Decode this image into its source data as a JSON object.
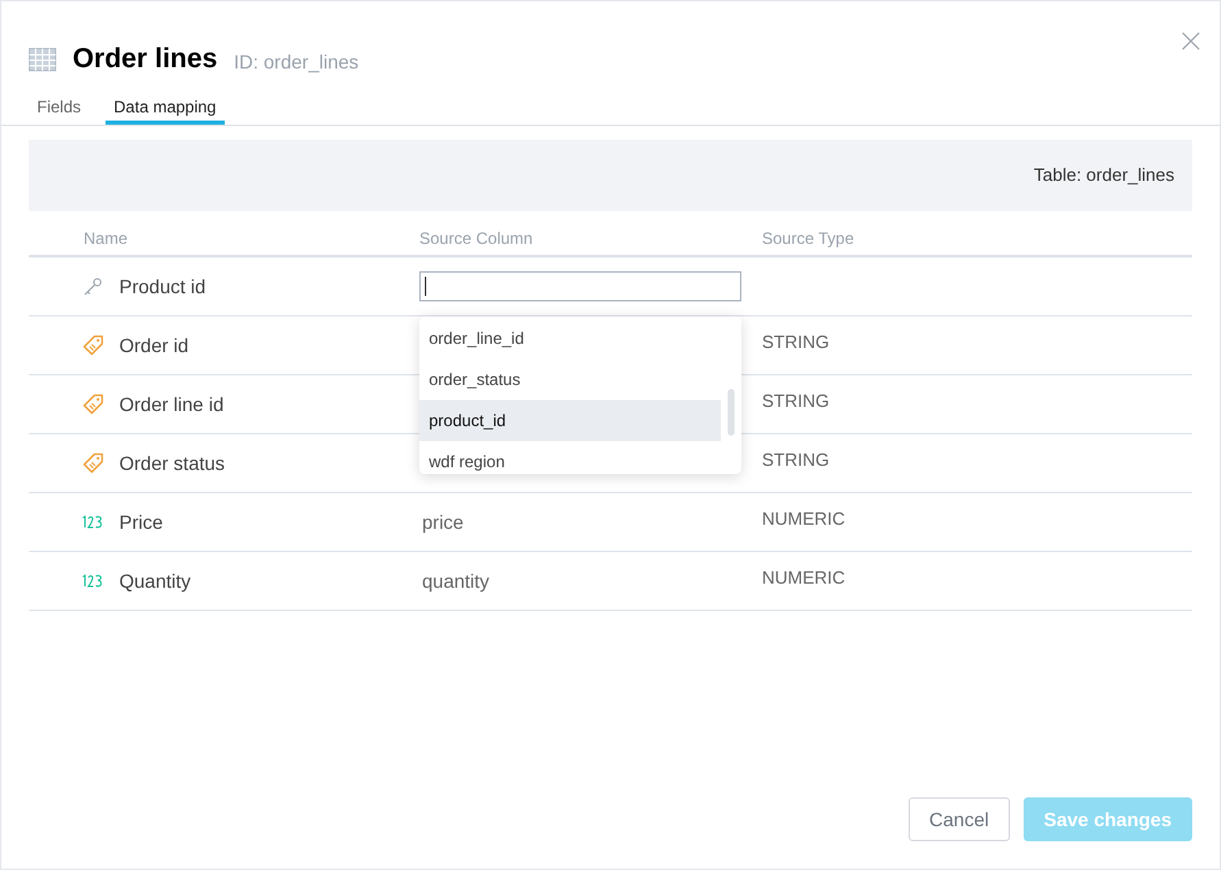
{
  "dialog": {
    "title": "Order lines",
    "id_label": "ID: order_lines"
  },
  "tabs": [
    {
      "label": "Fields",
      "selected": false
    },
    {
      "label": "Data mapping",
      "selected": true
    }
  ],
  "table_info": "Table: order_lines",
  "table": {
    "columns": [
      "Name",
      "Source Column",
      "Source Type"
    ],
    "rows": [
      {
        "kind": "key",
        "name": "Product id",
        "source": "",
        "type": "",
        "editing": true
      },
      {
        "kind": "tag",
        "name": "Order id",
        "source": "",
        "type": "STRING",
        "editing": false
      },
      {
        "kind": "tag",
        "name": "Order line id",
        "source": "",
        "type": "STRING",
        "editing": false
      },
      {
        "kind": "tag",
        "name": "Order status",
        "source": "",
        "type": "STRING",
        "editing": false
      },
      {
        "kind": "number",
        "name": "Price",
        "source": "price",
        "type": "NUMERIC",
        "editing": false
      },
      {
        "kind": "number",
        "name": "Quantity",
        "source": "quantity",
        "type": "NUMERIC",
        "editing": false
      }
    ]
  },
  "dropdown": {
    "options": [
      {
        "label": "order_line_id",
        "selected": false
      },
      {
        "label": "order_status",
        "selected": false
      },
      {
        "label": "product_id",
        "selected": true
      },
      {
        "label": "wdf region",
        "selected": false
      }
    ]
  },
  "buttons": [
    {
      "label": "Cancel",
      "kind": "secondary",
      "disabled": false
    },
    {
      "label": "Save changes",
      "kind": "primary",
      "disabled": true
    }
  ]
}
